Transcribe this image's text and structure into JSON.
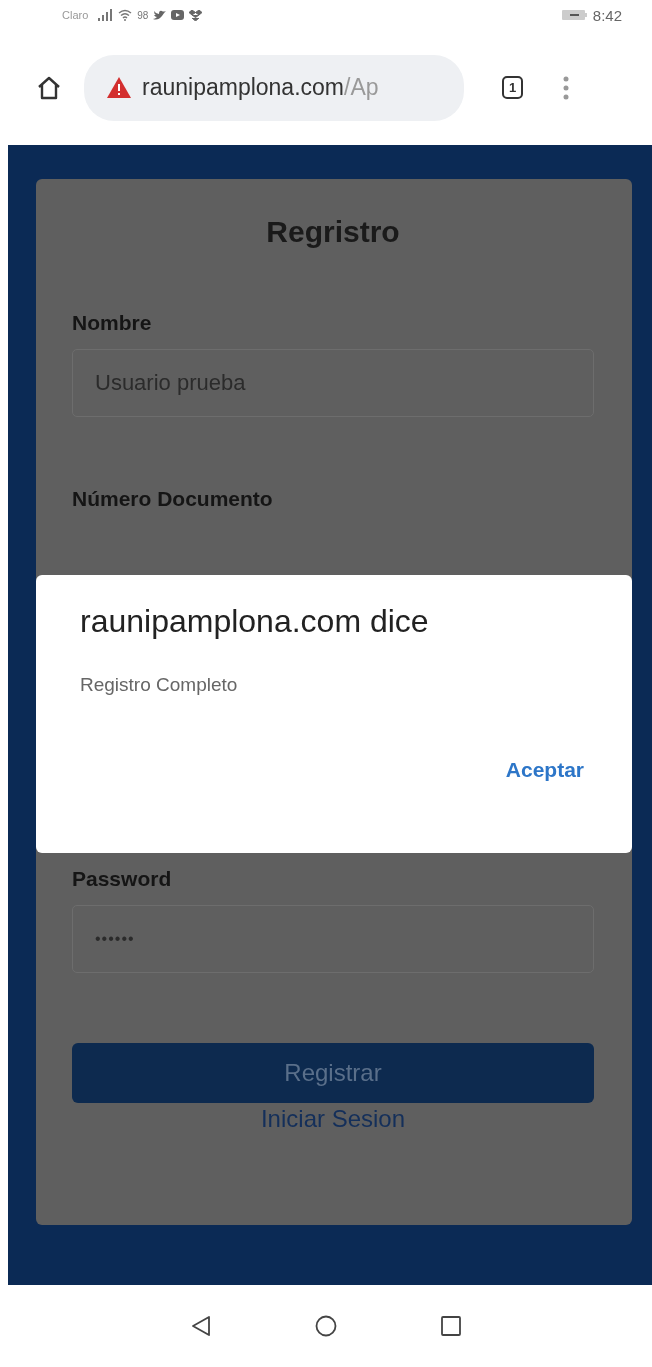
{
  "status_bar": {
    "carrier": "Claro",
    "wifi_strength": "98",
    "time": "8:42"
  },
  "browser": {
    "url_host": "raunipamplona.com",
    "url_path": "/Ap",
    "tab_count": "1"
  },
  "form": {
    "title": "Regristro",
    "fields": [
      {
        "label": "Nombre",
        "value": "Usuario prueba"
      },
      {
        "label": "Número Documento"
      },
      {
        "label": "Password",
        "value": "••••••"
      }
    ],
    "submit": "Registrar",
    "link": "Iniciar Sesion"
  },
  "dialog": {
    "title": "raunipamplona.com dice",
    "message": "Registro Completo",
    "button": "Aceptar"
  }
}
